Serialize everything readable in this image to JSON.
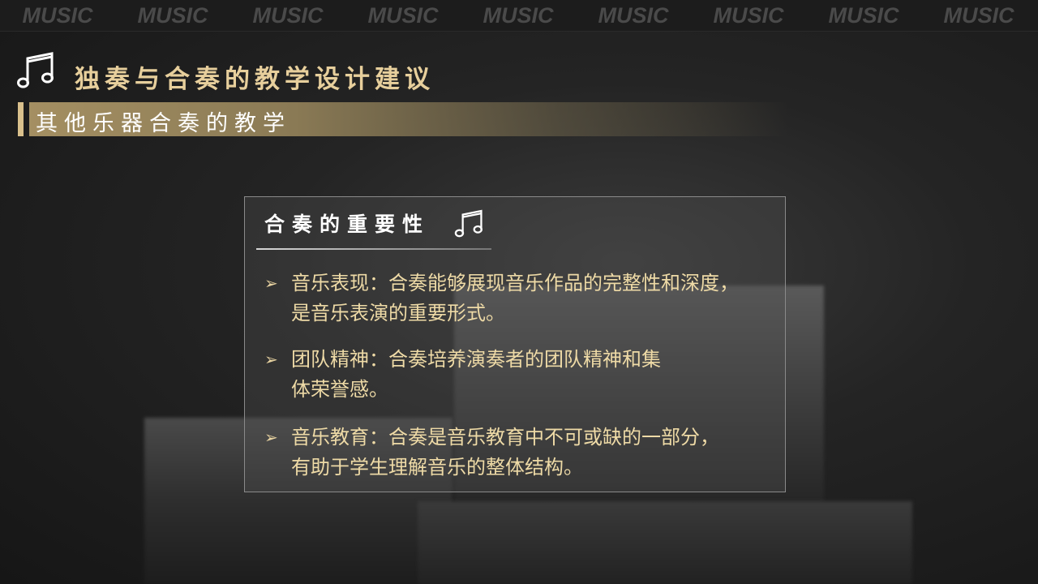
{
  "topbar": {
    "words": [
      "MUSIC",
      "MUSIC",
      "MUSIC",
      "MUSIC",
      "MUSIC",
      "MUSIC",
      "MUSIC",
      "MUSIC",
      "MUSIC"
    ]
  },
  "header": {
    "title": "独奏与合奏的教学设计建议",
    "icon": "music-note-icon"
  },
  "subheader": {
    "text": "其他乐器合奏的教学"
  },
  "card": {
    "title": "合奏的重要性",
    "title_icon": "music-note-icon",
    "bullets": [
      {
        "line1": "音乐表现：合奏能够展现音乐作品的完整性和深度，",
        "line2": "是音乐表演的重要形式。"
      },
      {
        "line1": "团队精神：合奏培养演奏者的团队精神和集",
        "line2": "体荣誉感。"
      },
      {
        "line1": "音乐教育：合奏是音乐教育中不可或缺的一部分，",
        "line2": "有助于学生理解音乐的整体结构。"
      }
    ]
  },
  "colors": {
    "accent_gold": "#e7cf9c",
    "bullet_text": "#eedaa6",
    "background": "#242424"
  }
}
